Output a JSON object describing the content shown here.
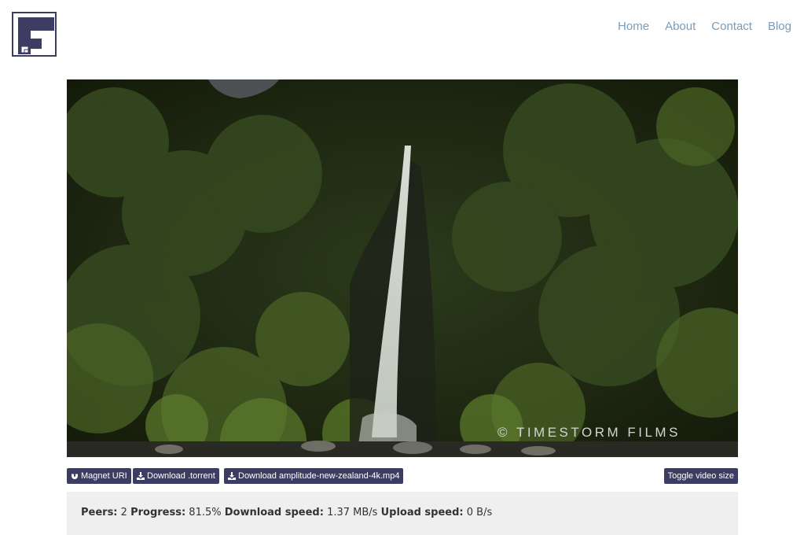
{
  "logo": {
    "letter": "F",
    "color": "#3d3d63"
  },
  "nav": {
    "items": [
      "Home",
      "About",
      "Contact",
      "Blog"
    ],
    "color": "#7a9cb8"
  },
  "video": {
    "watermark": "© TIMESTORM FILMS"
  },
  "controls": {
    "magnet_label": "Magnet URI",
    "torrent_label": "Download .torrent",
    "file_label": "Download amplitude-new-zealand-4k.mp4",
    "toggle_label": "Toggle video size",
    "button_color": "#3d3d63"
  },
  "stats": {
    "peers_label": "Peers:",
    "peers_value": "2",
    "progress_label": "Progress:",
    "progress_value": "81.5%",
    "download_label": "Download speed:",
    "download_value": "1.37 MB/s",
    "upload_label": "Upload speed:",
    "upload_value": "0 B/s"
  }
}
